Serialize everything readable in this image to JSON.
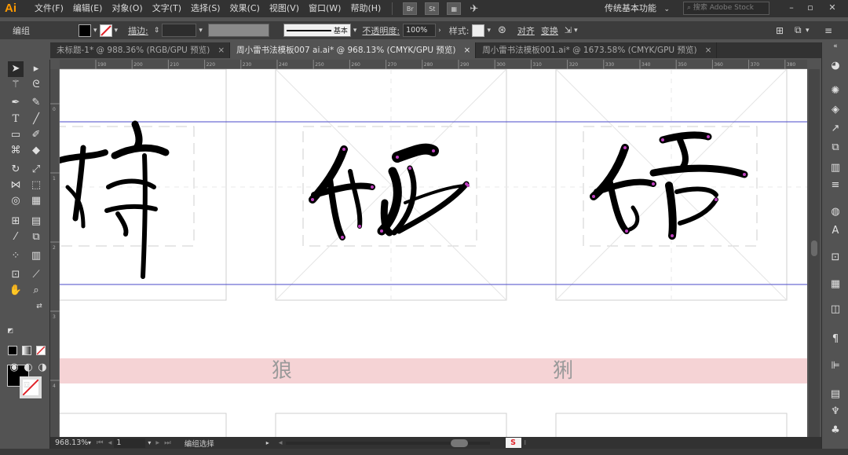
{
  "app": {
    "logo": "Ai"
  },
  "menu": [
    "文件(F)",
    "编辑(E)",
    "对象(O)",
    "文字(T)",
    "选择(S)",
    "效果(C)",
    "视图(V)",
    "窗口(W)",
    "帮助(H)"
  ],
  "menubar_buttons": [
    "Br",
    "St"
  ],
  "workspace": {
    "label": "传统基本功能"
  },
  "stock_search": {
    "placeholder": "搜索 Adobe Stock"
  },
  "controlbar": {
    "selection_label": "编组",
    "stroke_label": "描边:",
    "stroke_style_label": "基本",
    "opacity_label": "不透明度:",
    "opacity_value": "100%",
    "style_label": "样式:",
    "align_label": "对齐",
    "transform_label": "变换"
  },
  "tabs": [
    {
      "title": "未标题-1* @ 988.36% (RGB/GPU 预览)",
      "close": "×"
    },
    {
      "title": "周小雷书法模板007 ai.ai* @ 968.13% (CMYK/GPU 预览)",
      "close": "×"
    },
    {
      "title": "周小雷书法模板001.ai* @ 1673.58% (CMYK/GPU 预览)",
      "close": "×"
    }
  ],
  "hruler_ticks": [
    "190",
    "200",
    "210",
    "220",
    "230",
    "240",
    "250",
    "260",
    "270",
    "280",
    "290",
    "300",
    "310",
    "320",
    "330",
    "340",
    "350",
    "360",
    "370",
    "380"
  ],
  "vruler_ticks": [
    "0",
    "1",
    "2",
    "3",
    "4",
    "5"
  ],
  "canvas": {
    "band_chars": [
      "狼",
      "猁"
    ]
  },
  "statusbar": {
    "zoom": "968.13%",
    "page": "1",
    "tool_status": "编组选择"
  },
  "colors": {
    "guide": "#4a4ac8",
    "anchor": "#c040c0",
    "band": "#f5d3d5"
  }
}
